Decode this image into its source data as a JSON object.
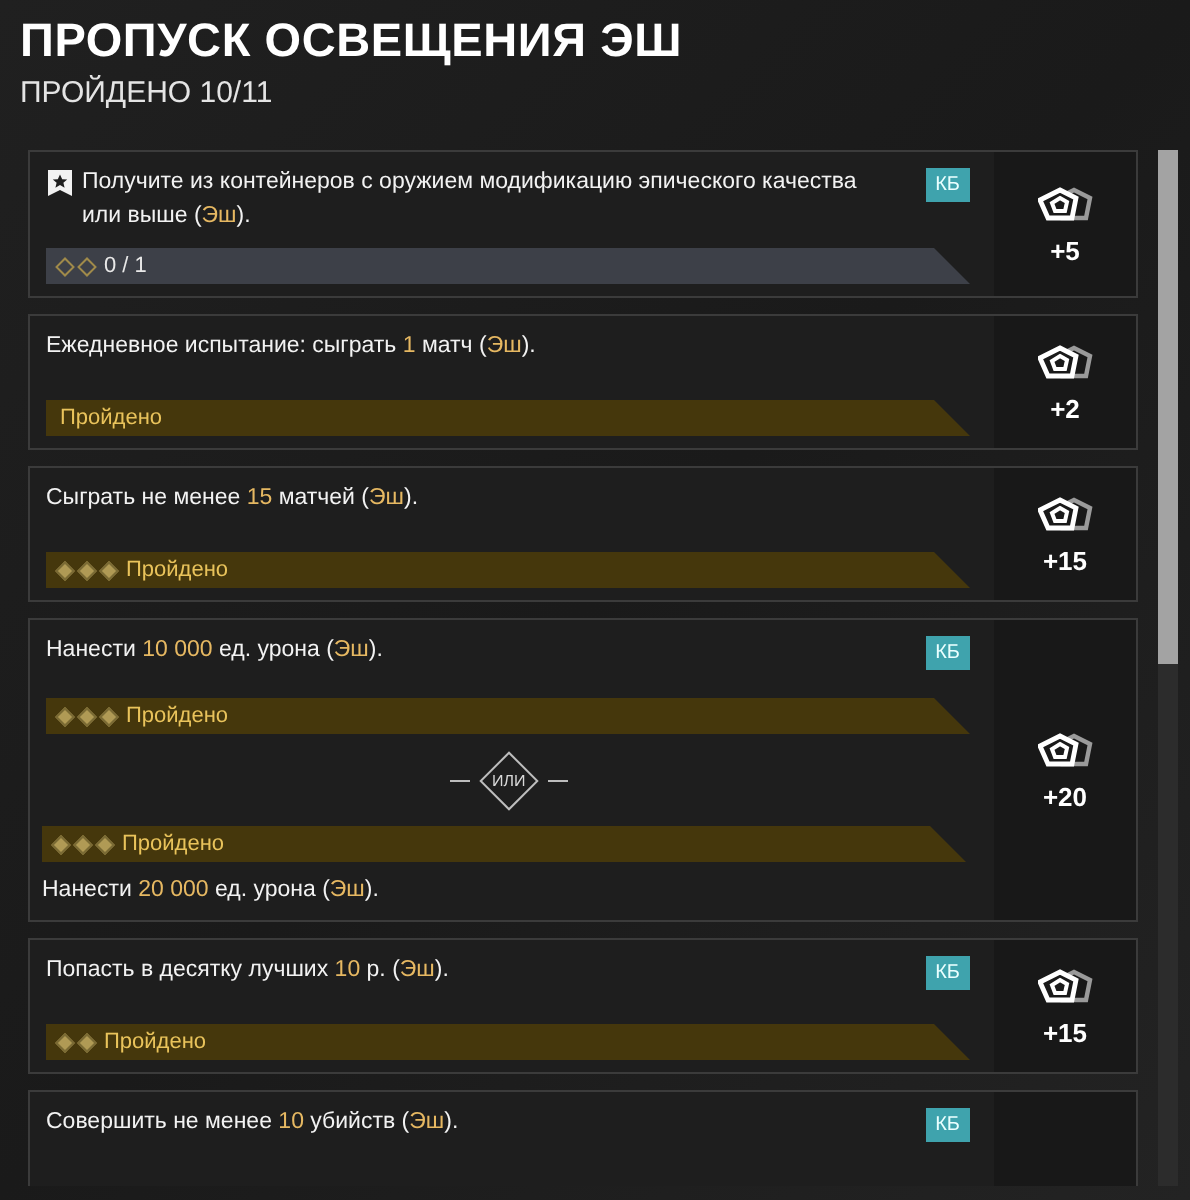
{
  "header": {
    "title": "ПРОПУСК ОСВЕЩЕНИЯ ЭШ",
    "subtitle": "ПРОЙДЕНО 10/11"
  },
  "quests": [
    {
      "kind": "single",
      "starred": true,
      "reward": "+5",
      "options": [
        {
          "parts": [
            {
              "text": "Получите из контейнеров с оружием модификацию эпического качества или выше (",
              "accent": false
            },
            {
              "text": "Эш",
              "accent": true
            },
            {
              "text": ").",
              "accent": false
            }
          ],
          "tag": "КБ",
          "progress": {
            "completed": false,
            "text": "0 / 1",
            "pips": [
              {
                "filled": false
              },
              {
                "filled": false
              }
            ]
          }
        }
      ]
    },
    {
      "kind": "single",
      "starred": false,
      "reward": "+2",
      "options": [
        {
          "parts": [
            {
              "text": "Ежедневное испытание: сыграть ",
              "accent": false
            },
            {
              "text": "1",
              "accent": true
            },
            {
              "text": " матч (",
              "accent": false
            },
            {
              "text": "Эш",
              "accent": true
            },
            {
              "text": ").",
              "accent": false
            }
          ],
          "progress": {
            "completed": true,
            "text": "Пройдено"
          }
        }
      ]
    },
    {
      "kind": "single",
      "starred": false,
      "reward": "+15",
      "options": [
        {
          "parts": [
            {
              "text": "Сыграть не менее ",
              "accent": false
            },
            {
              "text": "15",
              "accent": true
            },
            {
              "text": " матчей (",
              "accent": false
            },
            {
              "text": "Эш",
              "accent": true
            },
            {
              "text": ").",
              "accent": false
            }
          ],
          "progress": {
            "completed": true,
            "text": "Пройдено",
            "pips": [
              {
                "filled": true
              },
              {
                "filled": true
              },
              {
                "filled": true
              }
            ]
          }
        }
      ]
    },
    {
      "kind": "choice",
      "starred": false,
      "reward": "+20",
      "separator": "ИЛИ",
      "options": [
        {
          "parts": [
            {
              "text": "Нанести ",
              "accent": false
            },
            {
              "text": "10 000",
              "accent": true
            },
            {
              "text": " ед. урона (",
              "accent": false
            },
            {
              "text": "Эш",
              "accent": true
            },
            {
              "text": ").",
              "accent": false
            }
          ],
          "tag": "КБ",
          "progress": {
            "completed": true,
            "text": "Пройдено",
            "pips": [
              {
                "filled": true
              },
              {
                "filled": true
              },
              {
                "filled": true
              }
            ]
          }
        },
        {
          "parts": [
            {
              "text": "Нанести ",
              "accent": false
            },
            {
              "text": "20 000",
              "accent": true
            },
            {
              "text": " ед. урона (",
              "accent": false
            },
            {
              "text": "Эш",
              "accent": true
            },
            {
              "text": ").",
              "accent": false
            }
          ],
          "progress": {
            "completed": true,
            "text": "Пройдено",
            "pips": [
              {
                "filled": true
              },
              {
                "filled": true
              },
              {
                "filled": true
              }
            ]
          }
        }
      ]
    },
    {
      "kind": "single",
      "starred": false,
      "reward": "+15",
      "options": [
        {
          "parts": [
            {
              "text": "Попасть в десятку лучших ",
              "accent": false
            },
            {
              "text": "10",
              "accent": true
            },
            {
              "text": " р. (",
              "accent": false
            },
            {
              "text": "Эш",
              "accent": true
            },
            {
              "text": ").",
              "accent": false
            }
          ],
          "tag": "КБ",
          "progress": {
            "completed": true,
            "text": "Пройдено",
            "pips": [
              {
                "filled": true
              },
              {
                "filled": true
              }
            ]
          }
        }
      ]
    },
    {
      "kind": "single",
      "starred": false,
      "options": [
        {
          "parts": [
            {
              "text": "Совершить не менее ",
              "accent": false
            },
            {
              "text": "10",
              "accent": true
            },
            {
              "text": " убийств (",
              "accent": false
            },
            {
              "text": "Эш",
              "accent": true
            },
            {
              "text": ").",
              "accent": false
            }
          ],
          "tag": "КБ"
        }
      ]
    }
  ]
}
